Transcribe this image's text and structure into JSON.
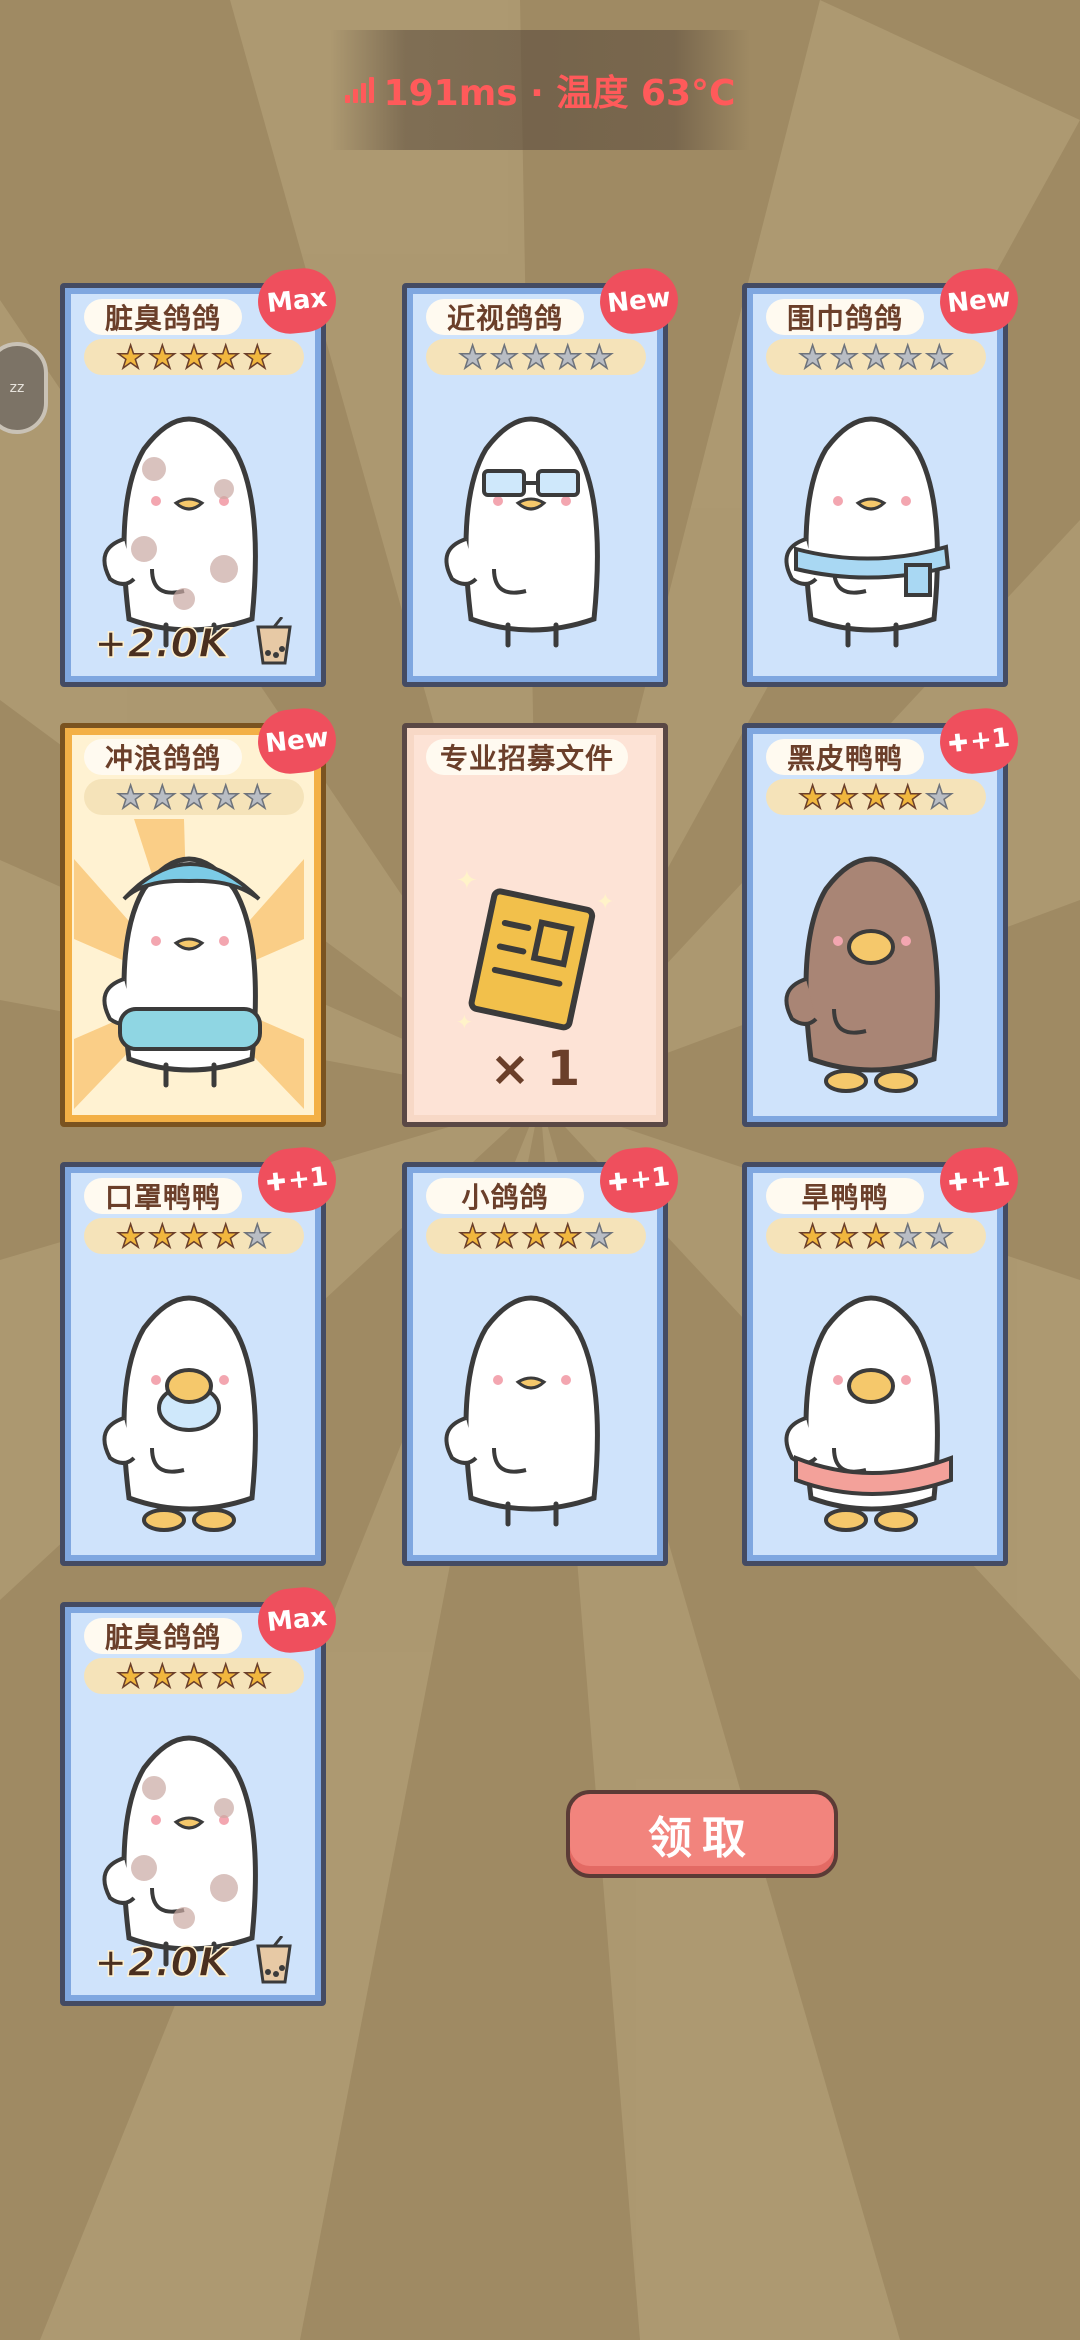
{
  "status": {
    "text": "191ms · 温度 63°C"
  },
  "side_button": {
    "label": "zz"
  },
  "cards": [
    {
      "name": "脏臭鸽鸽",
      "stars": 5,
      "badge": "Max",
      "bonus": "+2.0K",
      "variant": "blue"
    },
    {
      "name": "近视鸽鸽",
      "stars": 0,
      "badge": "New",
      "bonus": "",
      "variant": "blue"
    },
    {
      "name": "围巾鸽鸽",
      "stars": 0,
      "badge": "New",
      "bonus": "",
      "variant": "blue"
    },
    {
      "name": "冲浪鸽鸽",
      "stars": 0,
      "badge": "New",
      "bonus": "",
      "variant": "gold"
    },
    {
      "name": "专业招募文件",
      "count": "× 1",
      "variant": "file"
    },
    {
      "name": "黑皮鸭鸭",
      "stars": 4,
      "badge": "+1",
      "bonus": "",
      "variant": "blue"
    },
    {
      "name": "口罩鸭鸭",
      "stars": 4,
      "badge": "+1",
      "bonus": "",
      "variant": "blue"
    },
    {
      "name": "小鸽鸽",
      "stars": 4,
      "badge": "+1",
      "bonus": "",
      "variant": "blue"
    },
    {
      "name": "旱鸭鸭",
      "stars": 3,
      "badge": "+1",
      "bonus": "",
      "variant": "blue"
    },
    {
      "name": "脏臭鸽鸽",
      "stars": 5,
      "badge": "Max",
      "bonus": "+2.0K",
      "variant": "blue"
    }
  ],
  "claim_button": {
    "label": "领取"
  },
  "colors": {
    "badge": "#ef4f5d",
    "claim": "#f2847d",
    "background": "#9f8a63"
  }
}
